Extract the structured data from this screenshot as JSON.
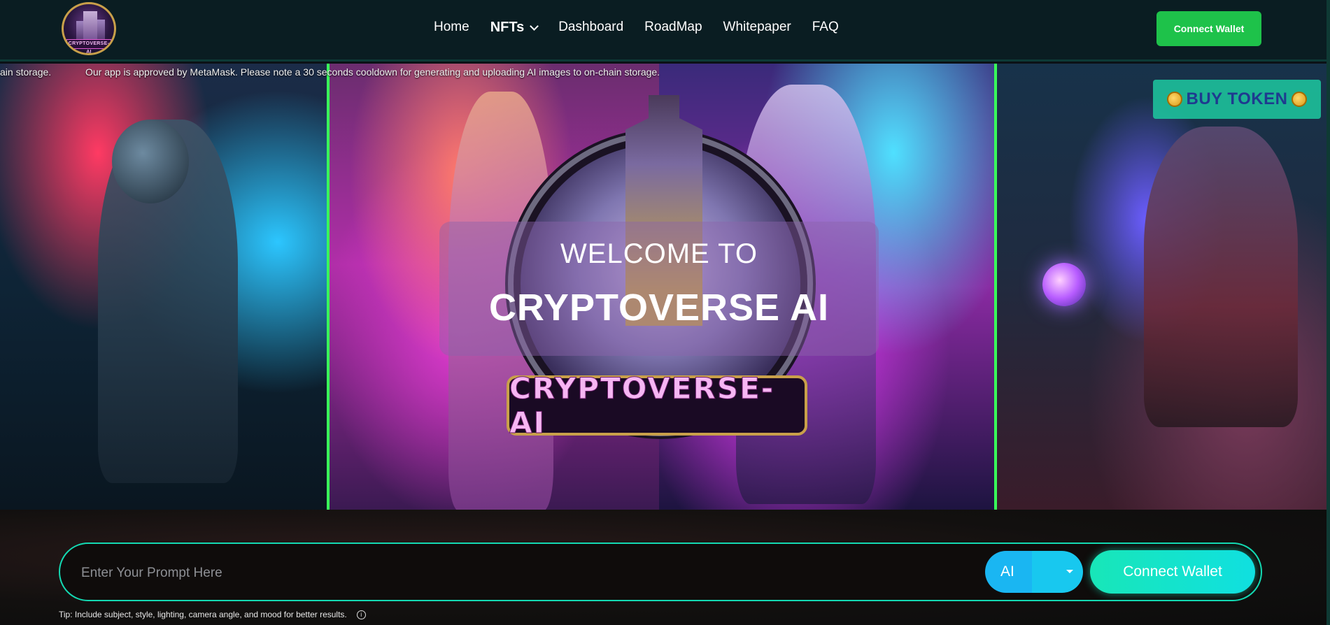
{
  "navbar": {
    "logo_text": "CRYPTOVERSE-AI",
    "links": [
      {
        "label": "Home"
      },
      {
        "label": "NFTs"
      },
      {
        "label": "Dashboard"
      },
      {
        "label": "RoadMap"
      },
      {
        "label": "Whitepaper"
      },
      {
        "label": "FAQ"
      }
    ],
    "connect_label": "Connect Wallet"
  },
  "ticker": {
    "fragment": "ain storage.",
    "message": "Our app is approved by MetaMask. Please note a 30 seconds cooldown for generating and uploading AI images to on-chain storage."
  },
  "hero": {
    "buy_token_label": "BUY TOKEN",
    "welcome_line1": "WELCOME TO",
    "welcome_line2": "CRYPTOVERSE AI",
    "banner_text": "CRYPTOVERSE-AI"
  },
  "prompt": {
    "placeholder": "Enter Your Prompt Here",
    "model_selected": "AI",
    "connect_label": "Connect Wallet",
    "tip": "Tip: Include subject, style, lighting, camera angle, and mood for better results."
  },
  "colors": {
    "nav_bg": "#0a1d22",
    "connect_green": "#1ec24a",
    "accent_teal": "#14d9b2",
    "panel_divider": "#39ff5a",
    "buy_token_bg": "#1dc9a0"
  }
}
